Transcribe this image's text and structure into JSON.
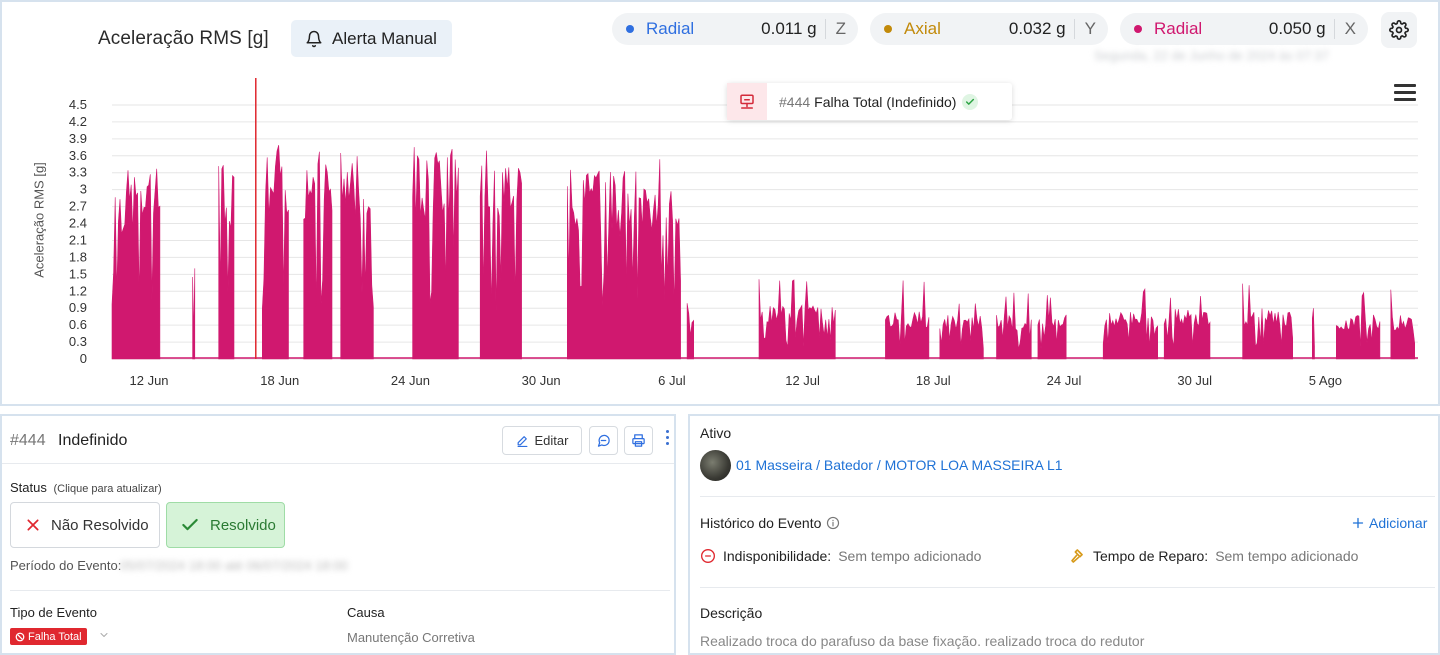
{
  "chart": {
    "title": "Aceleração RMS [g]",
    "alert_button": "Alerta Manual",
    "date_text": "Segunda, 22 de Junho de 2024 às 07:37",
    "pills": [
      {
        "label": "Radial",
        "value": "0.011 g",
        "axis": "Z",
        "color": "#2f6fe0"
      },
      {
        "label": "Axial",
        "value": "0.032 g",
        "axis": "Y",
        "color": "#c28a0a"
      },
      {
        "label": "Radial",
        "value": "0.050 g",
        "axis": "X",
        "color": "#d0186f"
      }
    ],
    "tooltip": {
      "number": "#444",
      "name": "Falha Total",
      "status": "(Indefinido)"
    }
  },
  "chart_data": {
    "type": "area",
    "ylabel": "Aceleração RMS [g]",
    "yticks": [
      "0",
      "0.3",
      "0.6",
      "0.9",
      "1.2",
      "1.5",
      "1.8",
      "2.1",
      "2.4",
      "2.7",
      "3",
      "3.3",
      "3.6",
      "3.9",
      "4.2",
      "4.5"
    ],
    "ylim": [
      0,
      4.5
    ],
    "xticks": [
      "12 Jun",
      "18 Jun",
      "24 Jun",
      "30 Jun",
      "6 Jul",
      "12 Jul",
      "18 Jul",
      "24 Jul",
      "30 Jul",
      "5 Ago"
    ],
    "event_marker_day": 6.6,
    "grid": true,
    "series": [
      {
        "name": "Radial X",
        "color": "#d0186f",
        "bursts": [
          {
            "start": 0.0,
            "end": 2.2,
            "level": 3.0,
            "peak": 3.6
          },
          {
            "start": 3.7,
            "end": 3.8,
            "level": 1.6,
            "peak": 1.7
          },
          {
            "start": 4.9,
            "end": 5.6,
            "level": 3.2,
            "peak": 3.7
          },
          {
            "start": 6.9,
            "end": 8.1,
            "level": 3.3,
            "peak": 3.8
          },
          {
            "start": 8.8,
            "end": 10.1,
            "level": 3.4,
            "peak": 3.8
          },
          {
            "start": 10.5,
            "end": 12.0,
            "level": 3.3,
            "peak": 3.8
          },
          {
            "start": 13.8,
            "end": 15.9,
            "level": 3.4,
            "peak": 3.8
          },
          {
            "start": 16.9,
            "end": 18.8,
            "level": 3.3,
            "peak": 3.7
          },
          {
            "start": 20.9,
            "end": 26.1,
            "level": 3.0,
            "peak": 3.6
          },
          {
            "start": 26.4,
            "end": 26.7,
            "level": 0.8,
            "peak": 1.0
          },
          {
            "start": 29.7,
            "end": 33.2,
            "level": 0.85,
            "peak": 1.5
          },
          {
            "start": 35.5,
            "end": 37.5,
            "level": 0.75,
            "peak": 1.5
          },
          {
            "start": 38.0,
            "end": 40.0,
            "level": 0.7,
            "peak": 1.0
          },
          {
            "start": 40.6,
            "end": 42.2,
            "level": 0.7,
            "peak": 1.2
          },
          {
            "start": 42.5,
            "end": 43.8,
            "level": 0.7,
            "peak": 1.2
          },
          {
            "start": 45.5,
            "end": 48.0,
            "level": 0.75,
            "peak": 1.3
          },
          {
            "start": 48.3,
            "end": 50.4,
            "level": 0.8,
            "peak": 1.2
          },
          {
            "start": 51.9,
            "end": 54.2,
            "level": 0.8,
            "peak": 1.4
          },
          {
            "start": 55.1,
            "end": 55.2,
            "level": 0.9,
            "peak": 0.9
          },
          {
            "start": 56.2,
            "end": 58.2,
            "level": 0.7,
            "peak": 1.2
          },
          {
            "start": 58.7,
            "end": 59.8,
            "level": 0.7,
            "peak": 1.3
          }
        ]
      }
    ]
  },
  "event": {
    "number": "#444",
    "name": "Indefinido",
    "edit_label": "Editar",
    "status_label": "Status",
    "status_hint": "(Clique para atualizar)",
    "unresolved_label": "Não Resolvido",
    "resolved_label": "Resolvido",
    "period_label": "Período do Evento:",
    "period_value": "05/07/2024 18:00 até 06/07/2024 18:00",
    "type_label": "Tipo de Evento",
    "type_value": "Falha Total",
    "cause_label": "Causa",
    "cause_value": "Manutenção Corretiva"
  },
  "detail": {
    "asset_label": "Ativo",
    "asset_path": "01 Masseira / Batedor / MOTOR LOA MASSEIRA L1",
    "history_label": "Histórico do Evento",
    "add_label": "Adicionar",
    "unavail_label": "Indisponibilidade:",
    "unavail_value": "Sem tempo adicionado",
    "repair_label": "Tempo de Reparo:",
    "repair_value": "Sem tempo adicionado",
    "description_label": "Descrição",
    "description_value": "Realizado troca do parafuso da base fixação. realizado troca do redutor"
  }
}
